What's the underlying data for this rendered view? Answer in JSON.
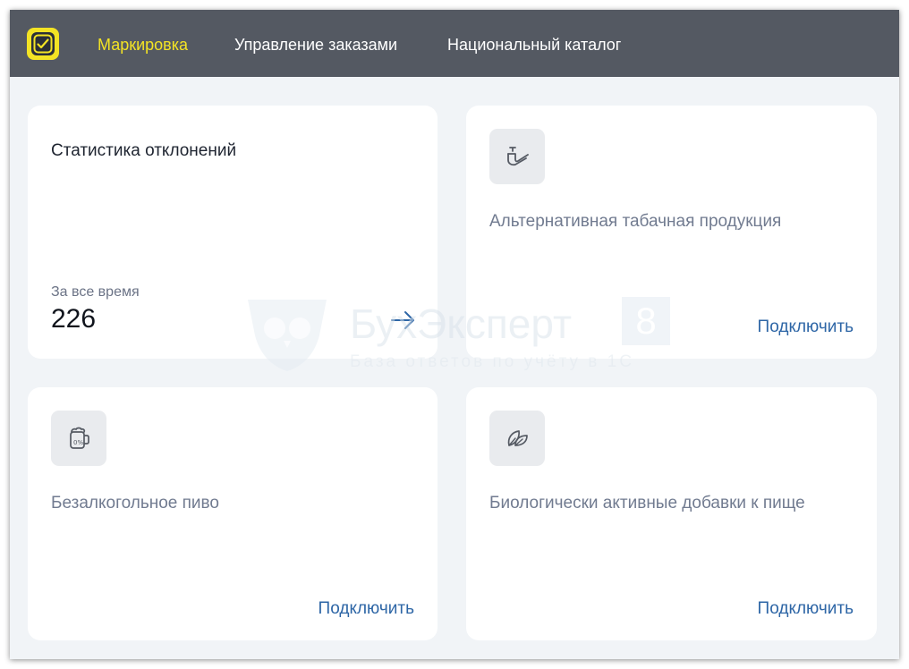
{
  "nav": {
    "items": [
      {
        "label": "Маркировка",
        "active": true
      },
      {
        "label": "Управление заказами",
        "active": false
      },
      {
        "label": "Национальный каталог",
        "active": false
      }
    ]
  },
  "stats": {
    "title": "Статистика отклонений",
    "period_label": "За все время",
    "value": "226"
  },
  "cards": {
    "tobacco": {
      "title": "Альтернативная табачная продукция",
      "action": "Подключить"
    },
    "beer": {
      "title": "Безалкогольное пиво",
      "action": "Подключить"
    },
    "supplements": {
      "title": "Биологически активные добавки к пище",
      "action": "Подключить"
    }
  },
  "watermark": {
    "brand": "БухЭксперт",
    "number": "8",
    "tagline": "База ответов по учёту в 1С"
  },
  "colors": {
    "topbar": "#545962",
    "accent_yellow": "#f3e324",
    "link_blue": "#2e66a6",
    "background": "#f1f4f7"
  },
  "icons": {
    "logo": "marking-check-icon",
    "tobacco": "pipe-icon",
    "beer": "beer-mug-icon",
    "supplements": "leaf-icon",
    "stats_action": "arrow-right-icon"
  }
}
